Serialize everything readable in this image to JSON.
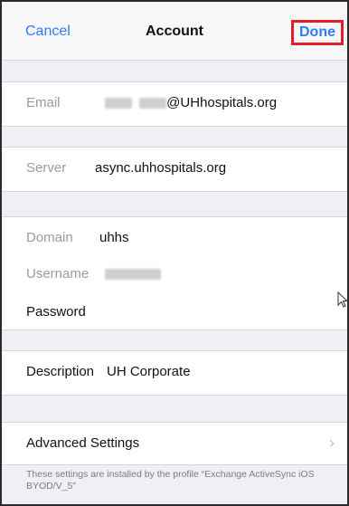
{
  "navbar": {
    "cancel_label": "Cancel",
    "title": "Account",
    "done_label": "Done"
  },
  "email": {
    "label": "Email",
    "value_suffix": "@UHhospitals.org"
  },
  "server": {
    "label": "Server",
    "value": "async.uhhospitals.org"
  },
  "domain": {
    "label": "Domain",
    "value": "uhhs"
  },
  "username": {
    "label": "Username"
  },
  "password": {
    "label": "Password"
  },
  "description": {
    "label": "Description",
    "value": "UH Corporate"
  },
  "advanced": {
    "label": "Advanced Settings"
  },
  "footer_note": "These settings are installed by the profile “Exchange ActiveSync iOS BYOD/V_5”",
  "colors": {
    "accent": "#2f7cf6",
    "highlight_border": "#e21f26",
    "background": "#f0eff5"
  }
}
